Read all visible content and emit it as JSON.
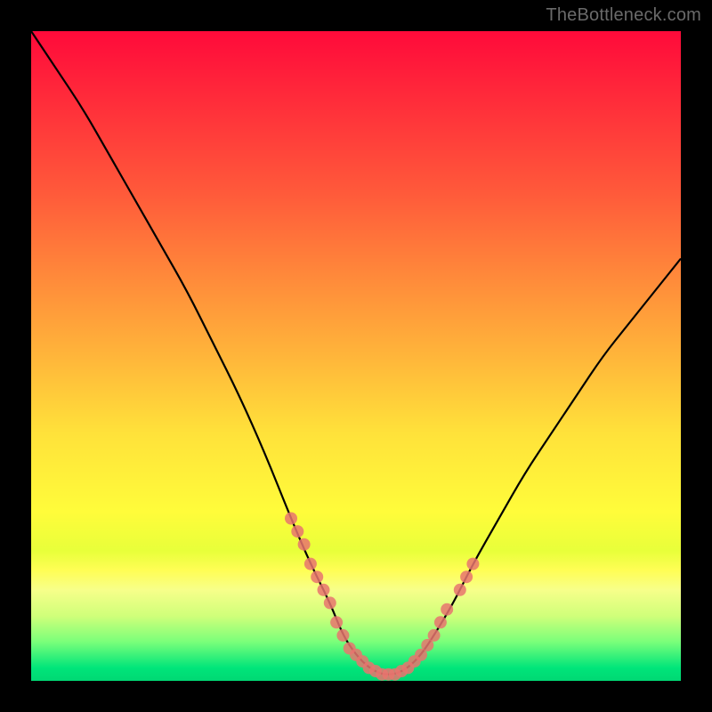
{
  "watermark": "TheBottleneck.com",
  "colors": {
    "curve": "#000000",
    "markers": "#e8746f",
    "gradient_top": "#ff0a3a",
    "gradient_mid": "#ffe23a",
    "gradient_bottom": "#00d873"
  },
  "chart_data": {
    "type": "line",
    "title": "",
    "xlabel": "",
    "ylabel": "",
    "xlim": [
      0,
      100
    ],
    "ylim": [
      0,
      100
    ],
    "series": [
      {
        "name": "curve",
        "x": [
          0,
          4,
          8,
          12,
          16,
          20,
          24,
          28,
          32,
          36,
          40,
          43,
          46,
          48,
          50,
          52,
          54,
          56,
          58,
          60,
          62,
          65,
          68,
          72,
          76,
          80,
          84,
          88,
          92,
          96,
          100
        ],
        "y": [
          100,
          94,
          88,
          81,
          74,
          67,
          60,
          52,
          44,
          35,
          25,
          18,
          12,
          7,
          4,
          2,
          1,
          1,
          2,
          4,
          7,
          12,
          18,
          25,
          32,
          38,
          44,
          50,
          55,
          60,
          65
        ]
      }
    ],
    "markers": {
      "name": "highlight-points",
      "x": [
        40,
        41,
        42,
        43,
        44,
        45,
        46,
        47,
        48,
        49,
        50,
        51,
        52,
        53,
        54,
        55,
        56,
        57,
        58,
        59,
        60,
        61,
        62,
        63,
        64,
        66,
        67,
        68
      ],
      "y": [
        25,
        23,
        21,
        18,
        16,
        14,
        12,
        9,
        7,
        5,
        4,
        3,
        2,
        1.5,
        1,
        1,
        1,
        1.5,
        2,
        3,
        4,
        5.5,
        7,
        9,
        11,
        14,
        16,
        18
      ]
    }
  }
}
